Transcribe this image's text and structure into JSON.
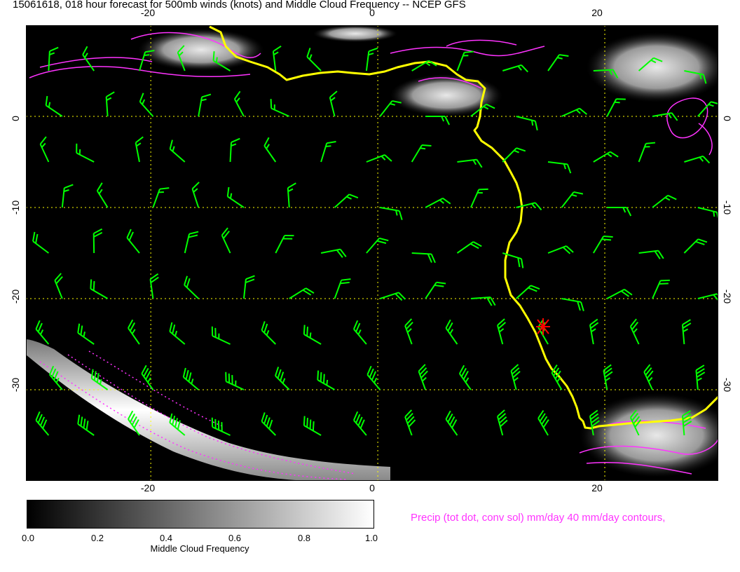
{
  "title": "15061618, 018 hour forecast for 500mb winds (knots) and Middle Cloud Frequency -- NCEP GFS",
  "axes": {
    "lon_ticks": [
      "-20",
      "0",
      "20"
    ],
    "lat_ticks": [
      "0",
      "-10",
      "-20",
      "-30"
    ],
    "lon_range": [
      -31,
      30
    ],
    "lat_range": [
      -40,
      10
    ]
  },
  "colorbar": {
    "label": "Middle Cloud Frequency",
    "ticks": [
      "0.0",
      "0.2",
      "0.4",
      "0.6",
      "0.8",
      "1.0"
    ],
    "range": [
      0.0,
      1.0
    ],
    "colors": [
      "#000000",
      "#ffffff"
    ]
  },
  "precip_legend": "Precip (tot dot, conv sol) mm/day 40 mm/day contours,",
  "colors": {
    "background": "#000000",
    "grid": "#ffff00",
    "wind_barbs": "#00ff00",
    "coastline": "#ffff00",
    "precip": "#ff33ff",
    "marker": "#ff0000"
  },
  "marker": {
    "icon": "red-star-icon",
    "lon": 15,
    "lat": -23.5
  },
  "wind_barb_rows": [
    {
      "lat": 5,
      "spacing_deg": 4,
      "speed_kt": 15
    },
    {
      "lat": 0,
      "spacing_deg": 4,
      "speed_kt": 15
    },
    {
      "lat": -5,
      "spacing_deg": 4,
      "speed_kt": 15
    },
    {
      "lat": -10,
      "spacing_deg": 4,
      "speed_kt": 15
    },
    {
      "lat": -15,
      "spacing_deg": 4,
      "speed_kt": 20
    },
    {
      "lat": -20,
      "spacing_deg": 4,
      "speed_kt": 20
    },
    {
      "lat": -25,
      "spacing_deg": 4,
      "speed_kt": 25
    },
    {
      "lat": -30,
      "spacing_deg": 4,
      "speed_kt": 35
    },
    {
      "lat": -35,
      "spacing_deg": 4,
      "speed_kt": 40
    }
  ]
}
